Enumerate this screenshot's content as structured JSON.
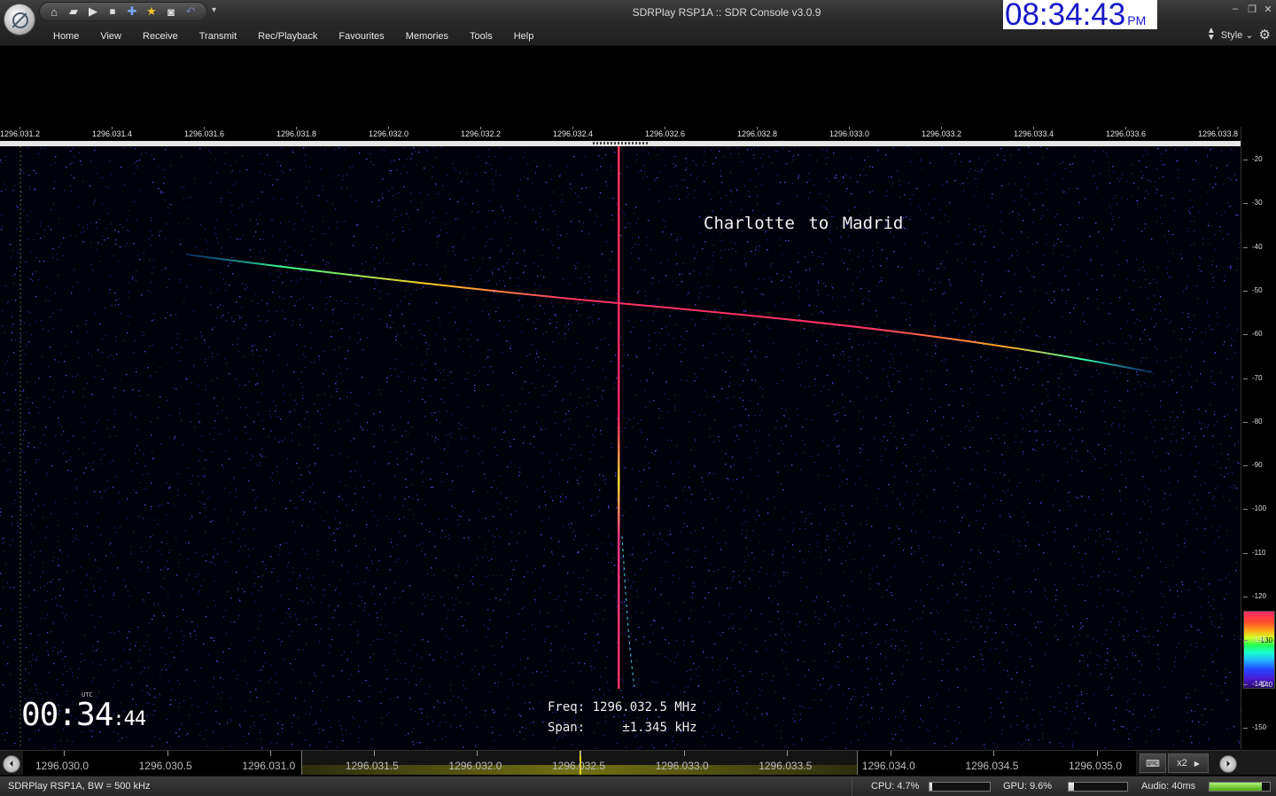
{
  "window": {
    "title": "SDRPlay RSP1A :: SDR Console v3.0.9",
    "controls": [
      "minimize-icon",
      "restore-icon",
      "close-icon"
    ]
  },
  "quick_access": {
    "icons": [
      "home-icon",
      "folder-icon",
      "play-icon",
      "stop-icon",
      "add-icon",
      "star-icon",
      "camera-icon",
      "undo-icon"
    ]
  },
  "clock": {
    "time": "08:34:43",
    "ampm": "PM"
  },
  "menu": {
    "items": [
      "Home",
      "View",
      "Receive",
      "Transmit",
      "Rec/Playback",
      "Favourites",
      "Memories",
      "Tools",
      "Help"
    ]
  },
  "style_label": "Style",
  "top_ruler": {
    "labels": [
      "1296.031.2",
      "1296.031.4",
      "1296.031.6",
      "1296.031.8",
      "1296.032.0",
      "1296.032.2",
      "1296.032.4",
      "1296.032.6",
      "1296.032.8",
      "1296.033.0",
      "1296.033.2",
      "1296.033.4",
      "1296.033.6",
      "1296.033.8"
    ]
  },
  "waterfall": {
    "annotation": "Charlotte to Madrid",
    "utc_label": "UTC",
    "utc_hm": "00:34",
    "utc_sec": ":44",
    "freq_label": "Freq:",
    "freq_value": "1296.032.5 MHz",
    "span_label": "Span:",
    "span_value": "±1.345 kHz"
  },
  "db_scale": {
    "labels": [
      "-20",
      "-30",
      "-40",
      "-50",
      "-60",
      "-70",
      "-80",
      "-90",
      "-100",
      "-110",
      "-120",
      "-130",
      "-140",
      "-150"
    ],
    "colorbar_top": "-130",
    "colorbar_bottom": "-140"
  },
  "overview": {
    "labels": [
      "1296.030.0",
      "1296.030.5",
      "1296.031.0",
      "1296.031.5",
      "1296.032.0",
      "1296.032.5",
      "1296.033.0",
      "1296.033.5",
      "1296.034.0",
      "1296.034.5",
      "1296.035.0"
    ],
    "zoom": "x2"
  },
  "status": {
    "device": "SDRPlay RSP1A, BW = 500 kHz",
    "cpu": "CPU: 4.7%",
    "gpu": "GPU: 9.6%",
    "audio": "Audio: 40ms",
    "cpu_level": 0.047,
    "gpu_level": 0.096,
    "audio_level": 0.9
  }
}
